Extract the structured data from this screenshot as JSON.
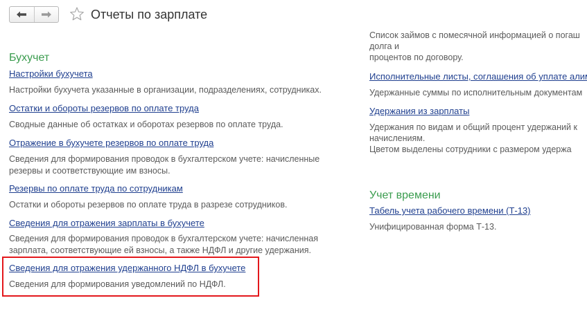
{
  "title": "Отчеты по зарплате",
  "left_column": {
    "section_title": "Бухучет",
    "items": [
      {
        "link": "Настройки бухучета",
        "desc_lines": [
          "Настройки бухучета указанные в организации, подразделениях, сотрудниках."
        ]
      },
      {
        "link": "Остатки и обороты резервов по оплате труда",
        "desc_lines": [
          "Сводные данные об остатках и оборотах резервов по оплате труда."
        ]
      },
      {
        "link": "Отражение в бухучете резервов по оплате труда",
        "desc_lines": [
          "Сведения для формирования проводок в бухгалтерском учете: начисленные",
          "резервы и соответствующие им взносы."
        ]
      },
      {
        "link": "Резервы по оплате труда по сотрудникам",
        "desc_lines": [
          "Остатки и обороты резервов по оплате труда в разрезе сотрудников."
        ]
      },
      {
        "link": "Сведения для отражения зарплаты в бухучете",
        "desc_lines": [
          "Сведения для формирования проводок в бухгалтерском учете: начисленная",
          "зарплата, соответствующие ей взносы, а также НДФЛ и другие удержания."
        ]
      },
      {
        "link": "Сведения для отражения удержанного НДФЛ в бухучете",
        "desc_lines": [
          "Сведения для формирования уведомлений по НДФЛ."
        ]
      }
    ]
  },
  "right_column": {
    "top_desc_lines": [
      "Список займов с помесячной информацией о погаш",
      "долга и",
      "процентов по договору."
    ],
    "items": [
      {
        "link": "Исполнительные листы, соглашения об уплате алим",
        "desc_lines": [
          "Удержанные суммы по исполнительным документам"
        ]
      },
      {
        "link": "Удержания из зарплаты",
        "desc_lines": [
          "Удержания по видам и общий процент удержаний к",
          "начислениям.",
          "Цветом выделены сотрудники с размером удержа"
        ]
      }
    ],
    "time_section": {
      "section_title": "Учет времени",
      "items": [
        {
          "link": "Табель учета рабочего времени (Т-13)",
          "desc_lines": [
            "Унифицированная форма Т-13."
          ]
        }
      ]
    }
  },
  "colors": {
    "section": "#3a9c4e",
    "link": "#1f3f8f",
    "highlight": "#e3171b"
  },
  "icons": [
    "back-arrow-icon",
    "forward-arrow-icon",
    "star-icon"
  ]
}
